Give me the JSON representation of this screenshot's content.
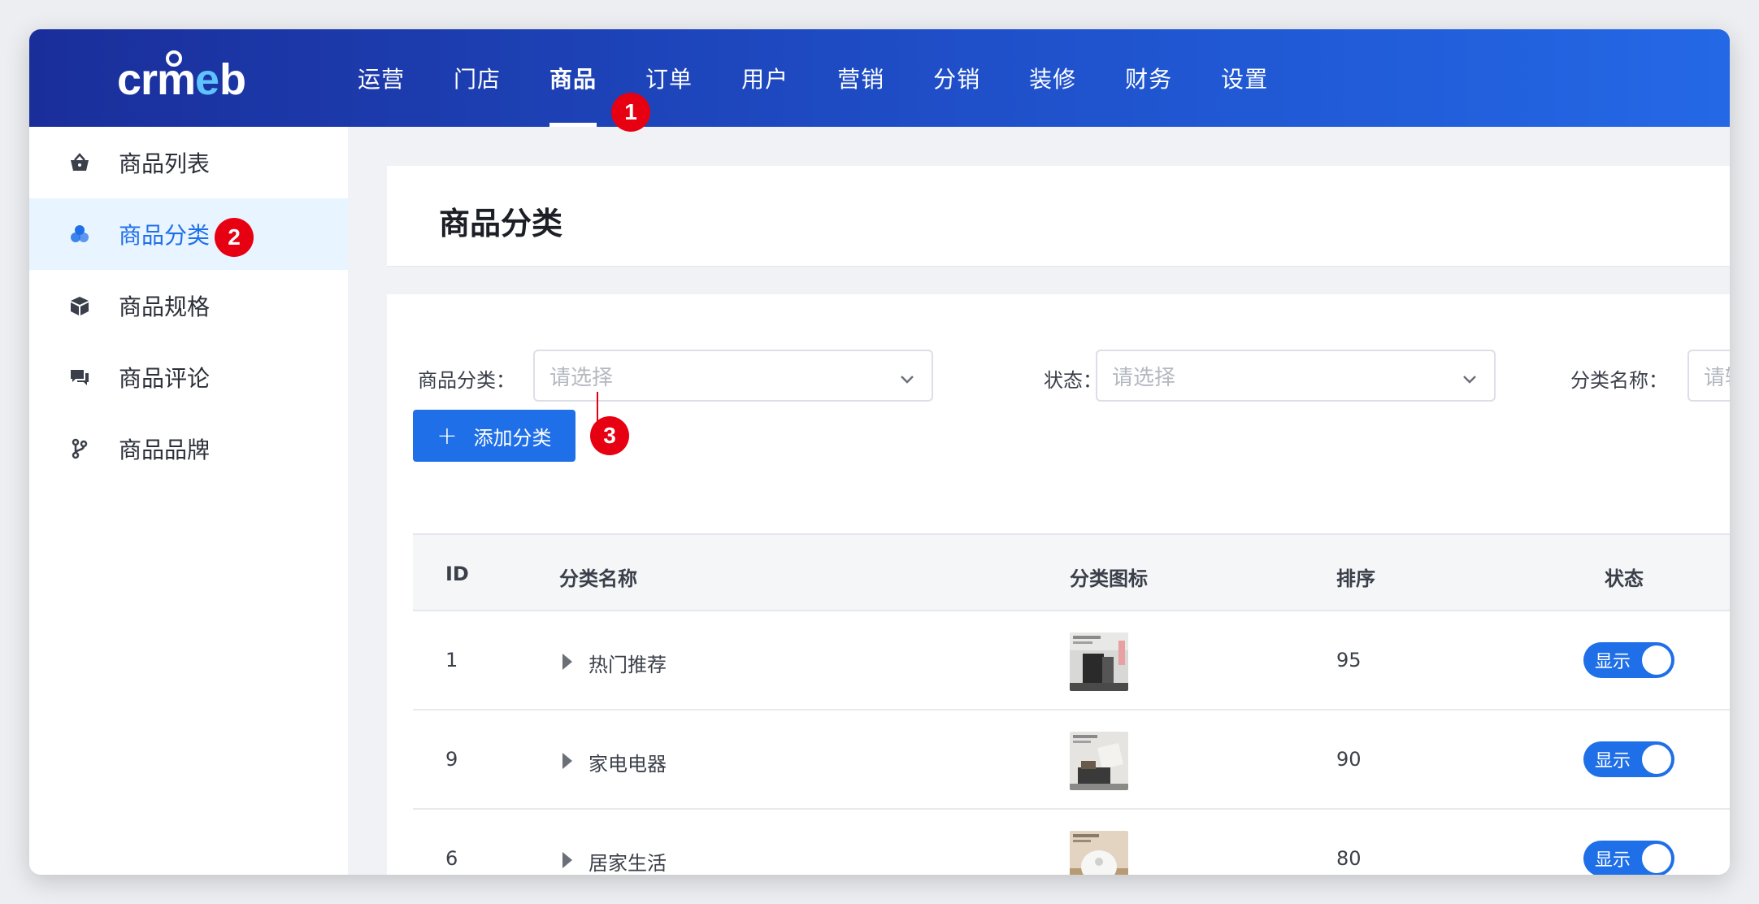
{
  "logo": {
    "text": "crmeb"
  },
  "nav": {
    "items": [
      {
        "label": "运营"
      },
      {
        "label": "门店"
      },
      {
        "label": "商品"
      },
      {
        "label": "订单"
      },
      {
        "label": "用户"
      },
      {
        "label": "营销"
      },
      {
        "label": "分销"
      },
      {
        "label": "装修"
      },
      {
        "label": "财务"
      },
      {
        "label": "设置"
      }
    ],
    "active": "商品"
  },
  "sidebar": {
    "items": [
      {
        "label": "商品列表",
        "icon": "basket-icon"
      },
      {
        "label": "商品分类",
        "icon": "category-icon"
      },
      {
        "label": "商品规格",
        "icon": "cube-icon"
      },
      {
        "label": "商品评论",
        "icon": "comment-icon"
      },
      {
        "label": "商品品牌",
        "icon": "brand-icon"
      }
    ],
    "active": "商品分类"
  },
  "badges": {
    "b1": "1",
    "b2": "2",
    "b3": "3"
  },
  "page": {
    "title": "商品分类"
  },
  "filters": {
    "category_label": "商品分类：",
    "category_placeholder": "请选择",
    "status_label": "状态：",
    "status_placeholder": "请选择",
    "name_label": "分类名称：",
    "name_placeholder": "请输入"
  },
  "toolbar": {
    "add_label": "添加分类"
  },
  "table": {
    "headers": {
      "id": "ID",
      "name": "分类名称",
      "icon": "分类图标",
      "sort": "排序",
      "status": "状态"
    },
    "rows": [
      {
        "id": "1",
        "name": "热门推荐",
        "sort": "95",
        "status": "显示"
      },
      {
        "id": "9",
        "name": "家电电器",
        "sort": "90",
        "status": "显示"
      },
      {
        "id": "6",
        "name": "居家生活",
        "sort": "80",
        "status": "显示"
      }
    ]
  },
  "colors": {
    "primary": "#1f6fe8",
    "header_dark": "#1a2e9a",
    "badge": "#e60012"
  }
}
